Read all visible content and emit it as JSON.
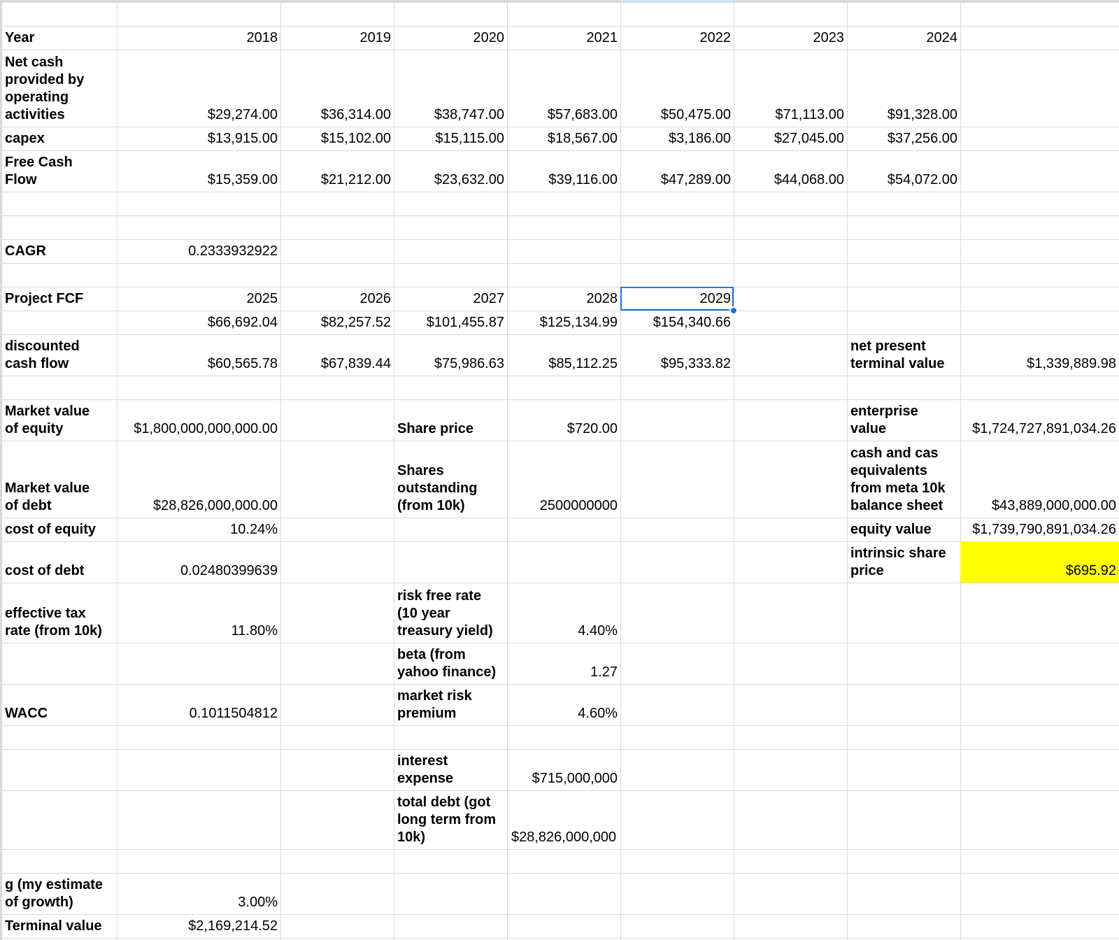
{
  "sheet": {
    "years_row": {
      "label": "Year",
      "values": [
        "2018",
        "2019",
        "2020",
        "2021",
        "2022",
        "2023",
        "2024"
      ]
    },
    "operating_cash_row": {
      "label": "Net cash\nprovided by\noperating\nactivities",
      "values": [
        "$29,274.00",
        "$36,314.00",
        "$38,747.00",
        "$57,683.00",
        "$50,475.00",
        "$71,113.00",
        "$91,328.00"
      ]
    },
    "capex_row": {
      "label": "capex",
      "values": [
        "$13,915.00",
        "$15,102.00",
        "$15,115.00",
        "$18,567.00",
        "$3,186.00",
        "$27,045.00",
        "$37,256.00"
      ]
    },
    "fcf_row": {
      "label": "Free Cash\nFlow",
      "values": [
        "$15,359.00",
        "$21,212.00",
        "$23,632.00",
        "$39,116.00",
        "$47,289.00",
        "$44,068.00",
        "$54,072.00"
      ]
    },
    "cagr": {
      "label": "CAGR",
      "value": "0.2333932922"
    },
    "projected_years": {
      "label": "Project FCF",
      "values": [
        "2025",
        "2026",
        "2027",
        "2028",
        "2029"
      ]
    },
    "projected_fcf": {
      "values": [
        "$66,692.04",
        "$82,257.52",
        "$101,455.87",
        "$125,134.99",
        "$154,340.66"
      ]
    },
    "discounted_cf": {
      "label": "discounted\ncash flow",
      "values": [
        "$60,565.78",
        "$67,839.44",
        "$75,986.63",
        "$85,112.25",
        "$95,333.82"
      ]
    },
    "net_present_terminal": {
      "label": "net present\nterminal value",
      "value": "$1,339,889.98"
    },
    "market_value_equity": {
      "label": "Market value\nof equity",
      "value": "$1,800,000,000,000.00"
    },
    "share_price": {
      "label": "Share price",
      "value": "$720.00"
    },
    "enterprise_value": {
      "label": "enterprise\nvalue",
      "value": "$1,724,727,891,034.26"
    },
    "cash_equivalents": {
      "label": "cash and cas\nequivalents\nfrom meta 10k\nbalance sheet",
      "value": "$43,889,000,000.00"
    },
    "market_value_debt": {
      "label": "Market value\nof debt",
      "value": "$28,826,000,000.00"
    },
    "shares_outstanding": {
      "label": "Shares\noutstanding\n(from 10k)",
      "value": "2500000000"
    },
    "cost_of_equity": {
      "label": "cost of equity",
      "value": "10.24%"
    },
    "equity_value": {
      "label": "equity value",
      "value": "$1,739,790,891,034.26"
    },
    "cost_of_debt": {
      "label": "cost of debt",
      "value": "0.02480399639"
    },
    "intrinsic_share_price": {
      "label": "intrinsic share\nprice",
      "value": "$695.92"
    },
    "risk_free_rate": {
      "label": "risk free rate\n(10 year\ntreasury yield)",
      "value": "4.40%"
    },
    "effective_tax_rate": {
      "label": "effective tax\nrate (from 10k)",
      "value": "11.80%"
    },
    "beta": {
      "label": "beta (from\nyahoo finance)",
      "value": "1.27"
    },
    "wacc": {
      "label": "WACC",
      "value": "0.1011504812"
    },
    "market_risk_premium": {
      "label": "market risk\npremium",
      "value": "4.60%"
    },
    "interest_expense": {
      "label": "interest\nexpense",
      "value": "$715,000,000"
    },
    "total_debt": {
      "label": "total debt (got\nlong term from\n10k)",
      "value": "$28,826,000,000"
    },
    "growth": {
      "label": "g (my estimate\nof growth)",
      "value": "3.00%"
    },
    "terminal_value": {
      "label": "Terminal value",
      "value": "$2,169,214.52"
    }
  },
  "colors": {
    "highlight": "#ffff00",
    "selection": "#1a73e8",
    "gridline": "#d9d9d9"
  }
}
